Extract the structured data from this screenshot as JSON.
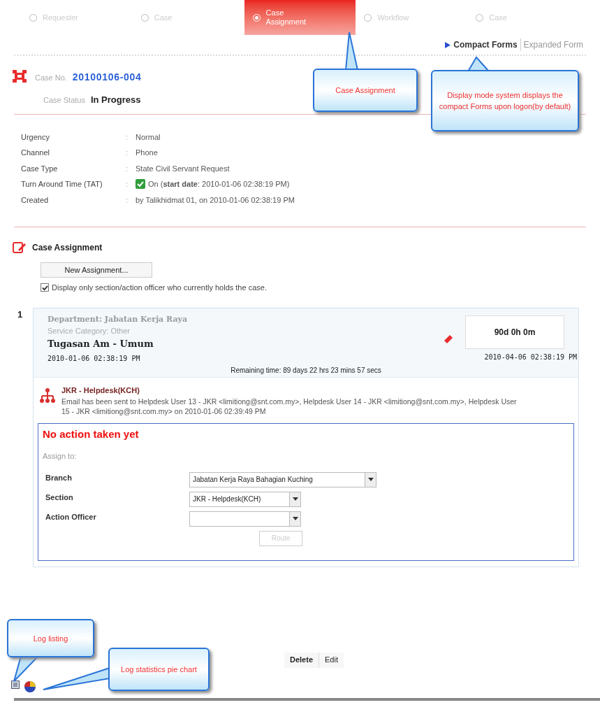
{
  "steps": [
    {
      "label": "Requester",
      "selected": false
    },
    {
      "label": "Case",
      "selected": false
    },
    {
      "label": "Case Assignment",
      "selected": true
    },
    {
      "label": "Workflow",
      "selected": false
    },
    {
      "label": "Case",
      "selected": false
    }
  ],
  "display_modes": [
    {
      "label": "Compact Forms",
      "selected": true
    },
    {
      "label": "Expanded Form",
      "selected": false
    }
  ],
  "case": {
    "number_label": "Case No.",
    "number": "20100106-004",
    "status_label": "Case Status",
    "status": "In Progress"
  },
  "field_separator": ":",
  "fields": [
    {
      "label": "Urgency",
      "value": "Normal"
    },
    {
      "label": "Channel",
      "value": "Phone"
    },
    {
      "label": "Case Type",
      "value": "State Civil Servant Request"
    },
    {
      "label": "Turn Around Time (TAT)",
      "value": "On (**start date**: 2010-01-06 02:38:19 PM)",
      "checked": true
    },
    {
      "label": "Created",
      "value": "by Talikhidmat 01, on 2010-01-06 02:38:19 PM"
    }
  ],
  "assignment": {
    "title": "Case Assignment",
    "new_button": "New Assignment...",
    "filter": {
      "label": "Display only section/action officer who currently holds the case.",
      "checked": true
    },
    "items": [
      {
        "index": "1",
        "department": "Department: Jabatan Kerja Raya",
        "category": "Service Category: Other",
        "title": "Tugasan Am - Umum",
        "start": "2010-01-06 02:38:19 PM",
        "duration": "90d 0h 0m",
        "end": "2010-04-06 02:38:19 PM",
        "remaining": "Remaining time: 89 days 22 hrs 23 mins 57 secs",
        "unit": "JKR - Helpdesk(KCH)",
        "email": "Email has been sent to Helpdesk User 13 - JKR <limitiong@snt.com.my>, Helpdesk User 14 - JKR <limitiong@snt.com.my>, Helpdesk User 15 - JKR <limitiong@snt.com.my> on 2010-01-06 02:39:49 PM"
      }
    ],
    "form": {
      "status": "No action taken yet",
      "assign_label": "Assign to:",
      "rows": [
        {
          "label": "Branch",
          "value": "Jabatan Kerja Raya Bahagian Kuching"
        },
        {
          "label": "Section",
          "value": "JKR - Helpdesk(KCH)"
        },
        {
          "label": "Action Officer",
          "value": ""
        }
      ],
      "submit": "Route"
    }
  },
  "actions": [
    "Delete",
    "Edit"
  ],
  "callouts": [
    {
      "kind": "tab",
      "text": "Case Assignment"
    },
    {
      "kind": "mode",
      "text": "Display mode system displays the compact Forms upon logon(by default)"
    },
    {
      "kind": "log",
      "text": "Log listing"
    },
    {
      "kind": "stats",
      "text": "Log statistics pie chart"
    }
  ]
}
